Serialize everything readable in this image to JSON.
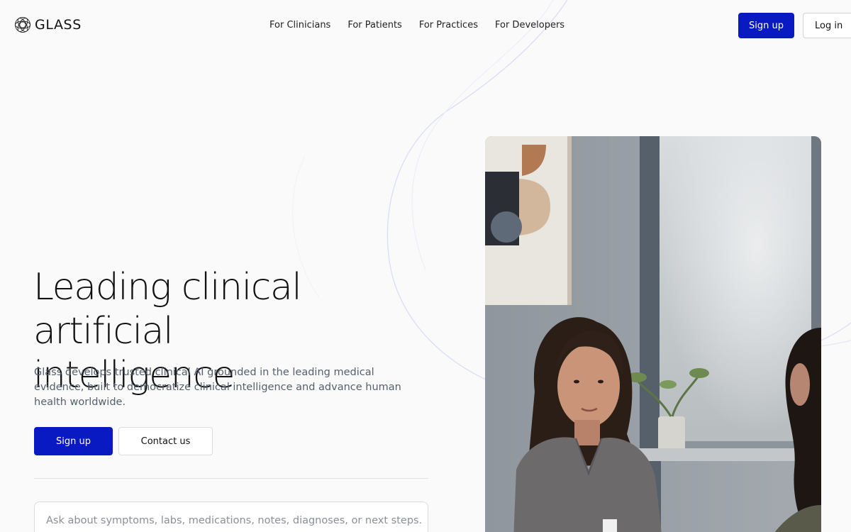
{
  "brand": {
    "name": "GLASS",
    "logo_icon": "glass-logo-icon"
  },
  "nav": {
    "links": [
      {
        "label": "For Clinicians"
      },
      {
        "label": "For Patients"
      },
      {
        "label": "For Practices"
      },
      {
        "label": "For Developers"
      }
    ]
  },
  "header_actions": {
    "signup_label": "Sign up",
    "login_label": "Log in"
  },
  "hero": {
    "title_line1": "Leading clinical artificial",
    "title_line2": "intelligence",
    "subtitle": "Glass develops trusted clinical AI grounded in the leading medical evidence, built to democratize clinical intelligence and advance human health worldwide.",
    "primary_cta": "Sign up",
    "secondary_cta": "Contact us"
  },
  "ask": {
    "placeholder": "Ask about symptoms, labs, medications, notes, diagnoses, or next steps..."
  },
  "colors": {
    "accent": "#0a1ac2",
    "background": "#fafafa",
    "subtitle": "#55606e"
  }
}
